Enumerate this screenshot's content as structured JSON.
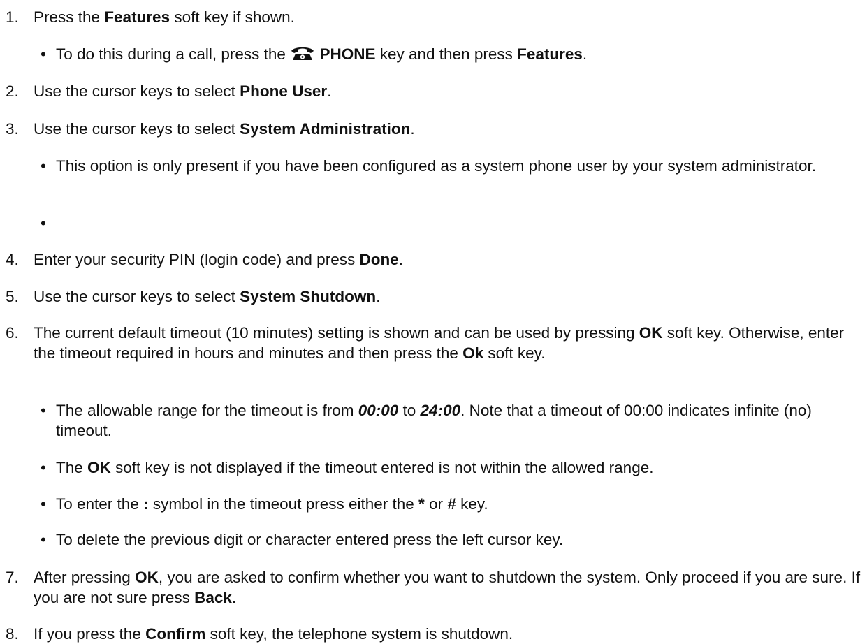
{
  "steps": [
    {
      "num": "1.",
      "t1": "Press the ",
      "b1": "Features",
      "t2": " soft key if shown."
    },
    {
      "num": "2.",
      "t1": "Use the cursor keys to select ",
      "b1": "Phone User",
      "t2": "."
    },
    {
      "num": "3.",
      "t1": "Use the cursor keys to select ",
      "b1": "System Administration",
      "t2": "."
    },
    {
      "num": "4.",
      "t1": "Enter your security PIN (login code) and press ",
      "b1": "Done",
      "t2": "."
    },
    {
      "num": "5.",
      "t1": "Use the cursor keys to select ",
      "b1": "System Shutdown",
      "t2": "."
    },
    {
      "num": "6.",
      "t1": "The current default timeout (10 minutes) setting is shown and can be used by pressing ",
      "b1": "OK",
      "t2": " soft key. Otherwise, enter the timeout required in hours and minutes and then press the ",
      "b2": "Ok",
      "t3": " soft key."
    },
    {
      "num": "7.",
      "t1": "After pressing ",
      "b1": "OK",
      "t2": ", you are asked to confirm whether you want to shutdown the system. Only proceed if you are sure. If you are not sure press ",
      "b2": "Back",
      "t3": "."
    },
    {
      "num": "8.",
      "t1": "If you press the ",
      "b1": "Confirm",
      "t2": " soft key, the telephone system is shutdown."
    }
  ],
  "bullets": {
    "s1": {
      "t1": "To do this during a call, press the ",
      "icon": "phone-icon",
      "b1": "PHONE",
      "t2": " key and then press ",
      "b2": "Features",
      "t3": "."
    },
    "s3a": {
      "t1": "This option is only present if you have been configured as a system phone user by your system administrator."
    },
    "s6a": {
      "t1": "The allowable range for the timeout is from ",
      "bi1": "00:00",
      "t2": " to ",
      "bi2": "24:00",
      "t3": ". Note that a timeout of 00:00 indicates infinite (no) timeout."
    },
    "s6b": {
      "t1": "The ",
      "b1": "OK",
      "t2": " soft key is not displayed if the timeout entered is not within the allowed range."
    },
    "s6c": {
      "t1": "To enter the ",
      "b1": ":",
      "t2": " symbol in the timeout press either the ",
      "b2": "*",
      "t3": " or ",
      "b3": "#",
      "t4": " key."
    },
    "s6d": {
      "t1": "To delete the previous digit or character entered press the left cursor key."
    }
  },
  "bullet_char": "•"
}
